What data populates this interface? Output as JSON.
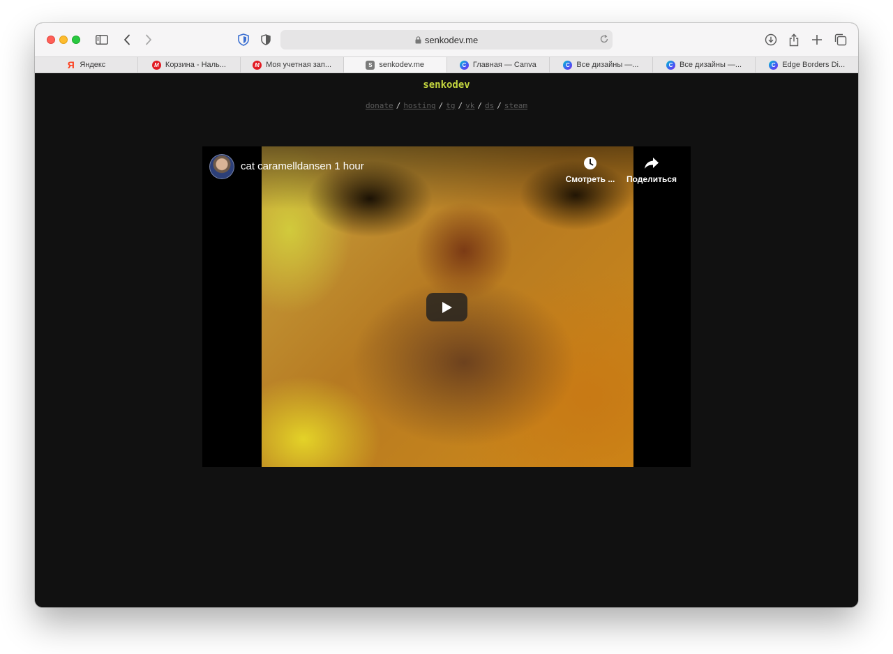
{
  "browser": {
    "address": "senkodev.me",
    "tabs": [
      {
        "label": "Яндекс",
        "favicon": "yandex",
        "favicon_text": "Я",
        "active": false
      },
      {
        "label": "Корзина - Наль...",
        "favicon": "mvideo",
        "favicon_text": "М",
        "active": false
      },
      {
        "label": "Моя учетная зап...",
        "favicon": "mvideo",
        "favicon_text": "М",
        "active": false
      },
      {
        "label": "senkodev.me",
        "favicon": "senkodev",
        "favicon_text": "S",
        "active": true
      },
      {
        "label": "Главная — Canva",
        "favicon": "canva",
        "favicon_text": "C",
        "active": false
      },
      {
        "label": "Все дизайны —...",
        "favicon": "canva",
        "favicon_text": "C",
        "active": false
      },
      {
        "label": "Все дизайны —...",
        "favicon": "canva",
        "favicon_text": "C",
        "active": false
      },
      {
        "label": "Edge Borders Di...",
        "favicon": "canva",
        "favicon_text": "C",
        "active": false
      }
    ]
  },
  "site": {
    "title": "senkodev",
    "links": [
      "donate",
      "hosting",
      "tg",
      "vk",
      "ds",
      "steam"
    ],
    "separator": "/"
  },
  "video": {
    "title": "cat caramelldansen 1 hour",
    "watch_later_label": "Смотреть ...",
    "share_label": "Поделиться"
  },
  "colors": {
    "site_title": "#c4d63f",
    "page_background": "#111111",
    "link": "#5b5b5b"
  }
}
